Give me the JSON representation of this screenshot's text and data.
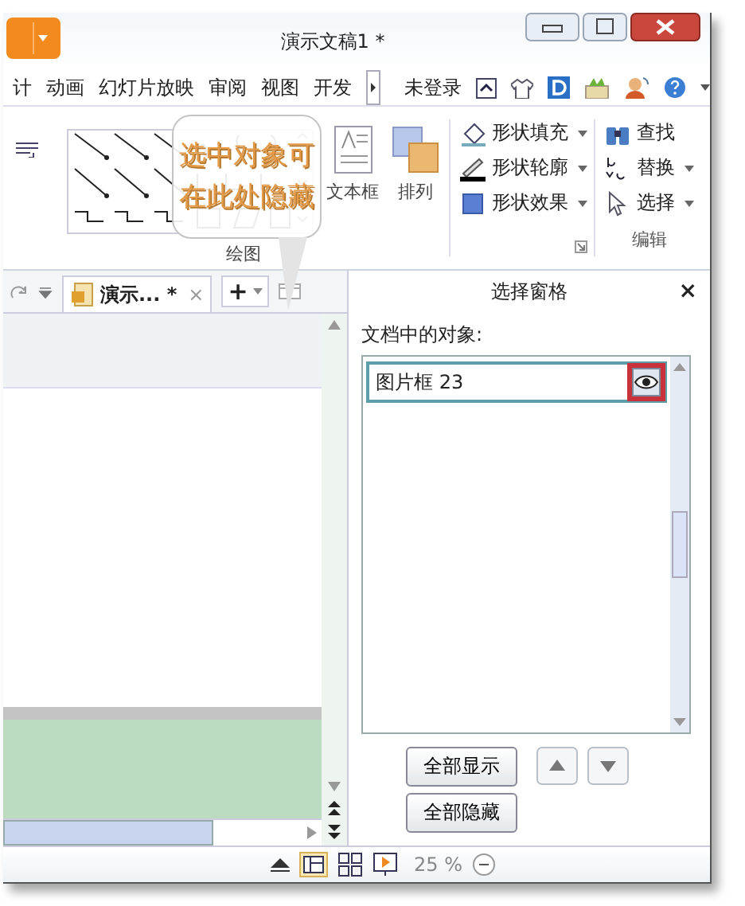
{
  "window": {
    "title": "演示文稿1 *"
  },
  "menu": [
    {
      "label": "计"
    },
    {
      "label": "动画"
    },
    {
      "label": "幻灯片放映"
    },
    {
      "label": "审阅"
    },
    {
      "label": "视图"
    },
    {
      "label": "开发"
    }
  ],
  "account": "未登录",
  "ribbon": {
    "textbox": "文本框",
    "arrange": "排列",
    "drawing_group": "绘图",
    "shape_commands": [
      {
        "label": "形状填充",
        "kind": "fill"
      },
      {
        "label": "形状轮廓",
        "kind": "outline"
      },
      {
        "label": "形状效果",
        "kind": "effect"
      }
    ],
    "edit_commands": [
      {
        "label": "查找",
        "kind": "find",
        "dropdown": false
      },
      {
        "label": "替换",
        "kind": "replace",
        "dropdown": true
      },
      {
        "label": "选择",
        "kind": "select",
        "dropdown": true
      }
    ],
    "edit_group": "编辑"
  },
  "callout": {
    "lines": [
      "选中对象可",
      "在此处隐藏"
    ]
  },
  "doc_tab": {
    "label": "演示... *",
    "close": "×",
    "add": "+"
  },
  "pane": {
    "title": "选择窗格",
    "close": "×",
    "objects_label": "文档中的对象:",
    "objects": [
      {
        "name": "图片框 23",
        "visible": true,
        "selected": true
      }
    ],
    "show_all": "全部显示",
    "hide_all": "全部隐藏"
  },
  "status": {
    "zoom": "25 %"
  }
}
